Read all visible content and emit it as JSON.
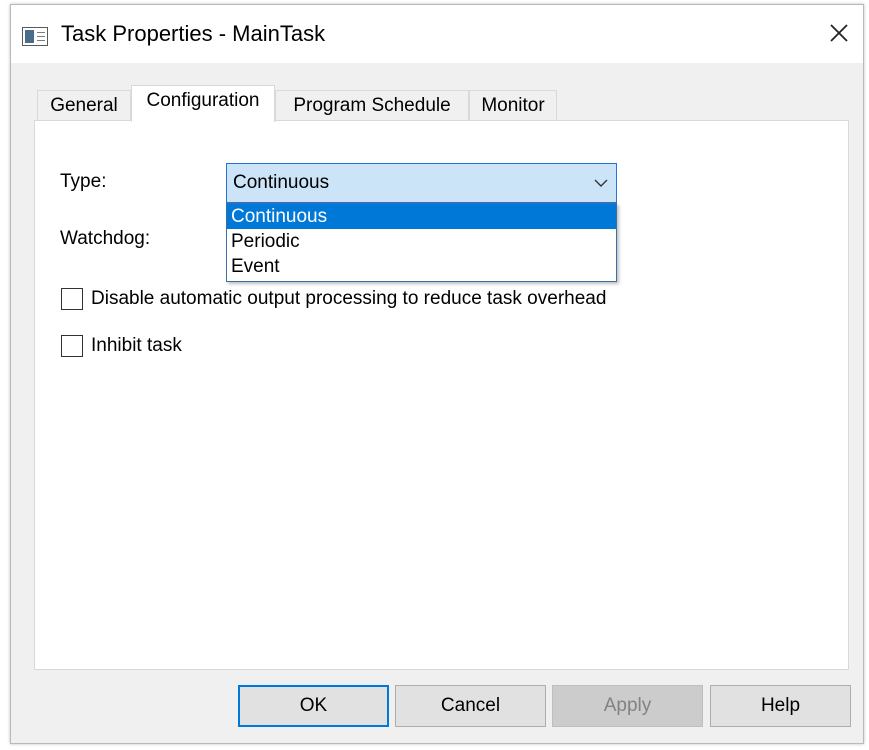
{
  "window": {
    "title": "Task Properties - MainTask"
  },
  "tabs": [
    {
      "label": "General"
    },
    {
      "label": "Configuration"
    },
    {
      "label": "Program Schedule"
    },
    {
      "label": "Monitor"
    }
  ],
  "active_tab": "Configuration",
  "config": {
    "type_label": "Type:",
    "type_value": "Continuous",
    "type_options": [
      "Continuous",
      "Periodic",
      "Event"
    ],
    "type_selected_option": "Continuous",
    "watchdog_label": "Watchdog:",
    "disable_output_label": "Disable automatic output processing to reduce task overhead",
    "disable_output_checked": false,
    "inhibit_label": "Inhibit task",
    "inhibit_checked": false
  },
  "buttons": {
    "ok": "OK",
    "cancel": "Cancel",
    "apply": "Apply",
    "help": "Help"
  },
  "colors": {
    "selection": "#0078d7",
    "combo_focus_bg": "#cce4f7",
    "dialog_bg": "#f0f0f0"
  }
}
